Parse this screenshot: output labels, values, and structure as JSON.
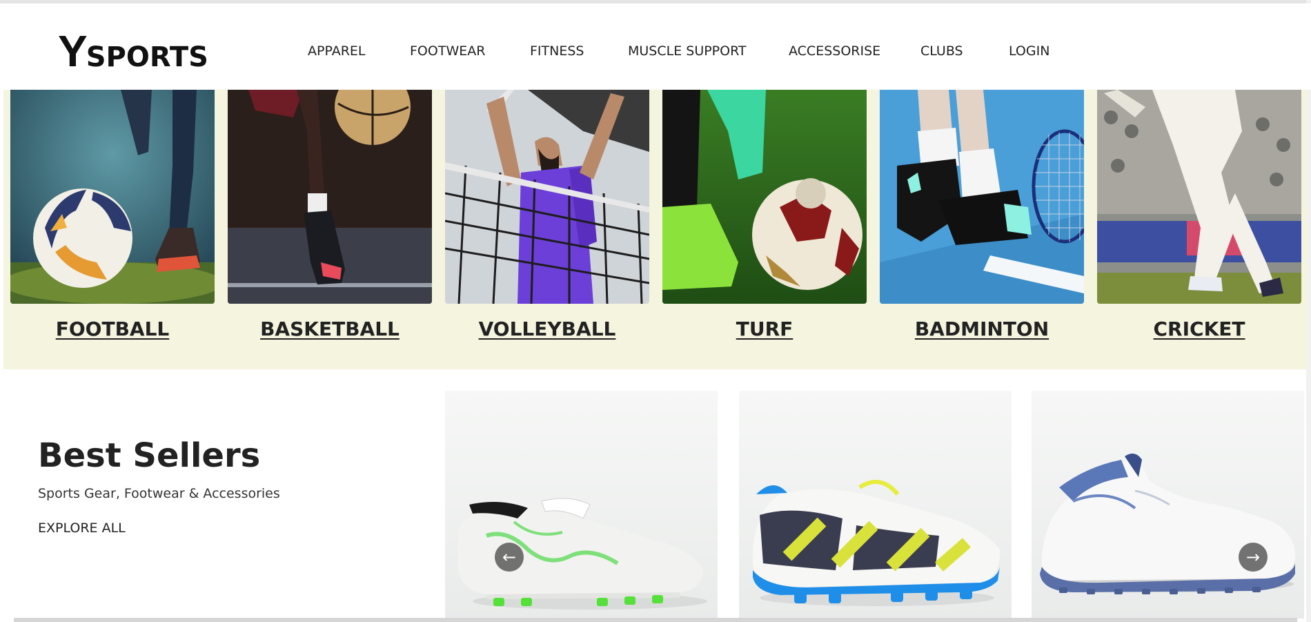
{
  "brand": {
    "logo_letter": "Y",
    "logo_text": "SPORTS"
  },
  "nav": [
    {
      "label": "APPAREL"
    },
    {
      "label": "FOOTWEAR"
    },
    {
      "label": "FITNESS"
    },
    {
      "label": "MUSCLE SUPPORT"
    },
    {
      "label": "ACCESSORISE"
    },
    {
      "label": "CLUBS"
    },
    {
      "label": "LOGIN"
    }
  ],
  "categories": [
    {
      "label": "FOOTBALL"
    },
    {
      "label": "BASKETBALL"
    },
    {
      "label": "VOLLEYBALL"
    },
    {
      "label": "TURF"
    },
    {
      "label": "BADMINTON"
    },
    {
      "label": "CRICKET"
    }
  ],
  "best_sellers": {
    "title": "Best Sellers",
    "subtitle": "Sports Gear, Footwear & Accessories",
    "link": "EXPLORE ALL"
  },
  "carousel": {
    "prev_icon": "arrow-left-icon",
    "next_icon": "arrow-right-icon",
    "products": [
      {
        "name": "white-green-football-boot"
      },
      {
        "name": "blue-yellow-football-boot"
      },
      {
        "name": "white-blue-cricket-shoe"
      }
    ]
  },
  "colors": {
    "category_band": "#f4f4df",
    "text": "#222222"
  }
}
